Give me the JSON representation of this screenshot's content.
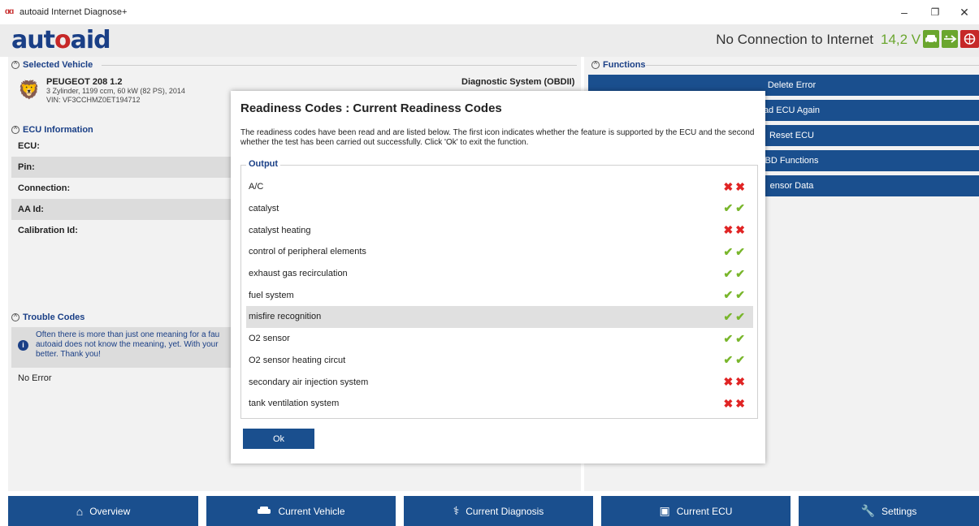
{
  "window": {
    "title": "autoaid Internet Diagnose+",
    "minimize": "–",
    "maximize": "❐",
    "close": "✕"
  },
  "header": {
    "logo_a": "aut",
    "logo_o": "o",
    "logo_b": "aid",
    "connection": "No Connection to Internet",
    "voltage": "14,2 V",
    "icons": [
      "car-icon",
      "usb-icon",
      "globe-icon"
    ],
    "colors": {
      "voltage": "#6aa62e",
      "brand": "#1a3f86",
      "accent": "#c62828"
    }
  },
  "selected_vehicle": {
    "title": "Selected Vehicle",
    "name": "PEUGEOT 208 1.2",
    "specs": "3 Zylinder, 1199 ccm, 60 kW (82 PS), 2014",
    "vin": "VIN: VF3CCHMZ0ET194712",
    "diagnostic_system": "Diagnostic System (OBDII)"
  },
  "ecu_info": {
    "title": "ECU Information",
    "rows": [
      "ECU:",
      "Pin:",
      "Connection:",
      "AA Id:",
      "Calibration Id:"
    ]
  },
  "trouble_codes": {
    "title": "Trouble Codes",
    "note_lines": [
      "Often there is more than just one meaning for a fau",
      "autoaid does not know the meaning, yet. With your",
      "better. Thank you!"
    ],
    "status": "No Error"
  },
  "functions": {
    "title": "Functions",
    "buttons": [
      "Delete Error",
      "ad ECU Again",
      "Reset ECU",
      "BD Functions",
      "ensor Data"
    ]
  },
  "modal": {
    "title": "Readiness Codes : Current Readiness Codes",
    "description": "The readiness codes have been read and are listed below. The first icon indicates whether the feature is supported by the ECU and the second whether the test has been carried out successfully. Click 'Ok' to exit the function.",
    "output_label": "Output",
    "ok_label": "Ok",
    "rows": [
      {
        "label": "A/C",
        "supported": false,
        "completed": false
      },
      {
        "label": "catalyst",
        "supported": true,
        "completed": true
      },
      {
        "label": "catalyst heating",
        "supported": false,
        "completed": false
      },
      {
        "label": "control of peripheral elements",
        "supported": true,
        "completed": true
      },
      {
        "label": "exhaust gas recirculation",
        "supported": true,
        "completed": true
      },
      {
        "label": "fuel system",
        "supported": true,
        "completed": true
      },
      {
        "label": "misfire recognition",
        "supported": true,
        "completed": true,
        "highlighted": true
      },
      {
        "label": "O2 sensor",
        "supported": true,
        "completed": true
      },
      {
        "label": "O2 sensor heating circut",
        "supported": true,
        "completed": true
      },
      {
        "label": "secondary air injection system",
        "supported": false,
        "completed": false
      },
      {
        "label": "tank ventilation system",
        "supported": false,
        "completed": false
      }
    ]
  },
  "nav": [
    {
      "label": "Overview",
      "icon": "home-icon"
    },
    {
      "label": "Current Vehicle",
      "icon": "car-icon"
    },
    {
      "label": "Current Diagnosis",
      "icon": "stethoscope-icon"
    },
    {
      "label": "Current ECU",
      "icon": "chip-icon"
    },
    {
      "label": "Settings",
      "icon": "wrench-icon"
    }
  ]
}
